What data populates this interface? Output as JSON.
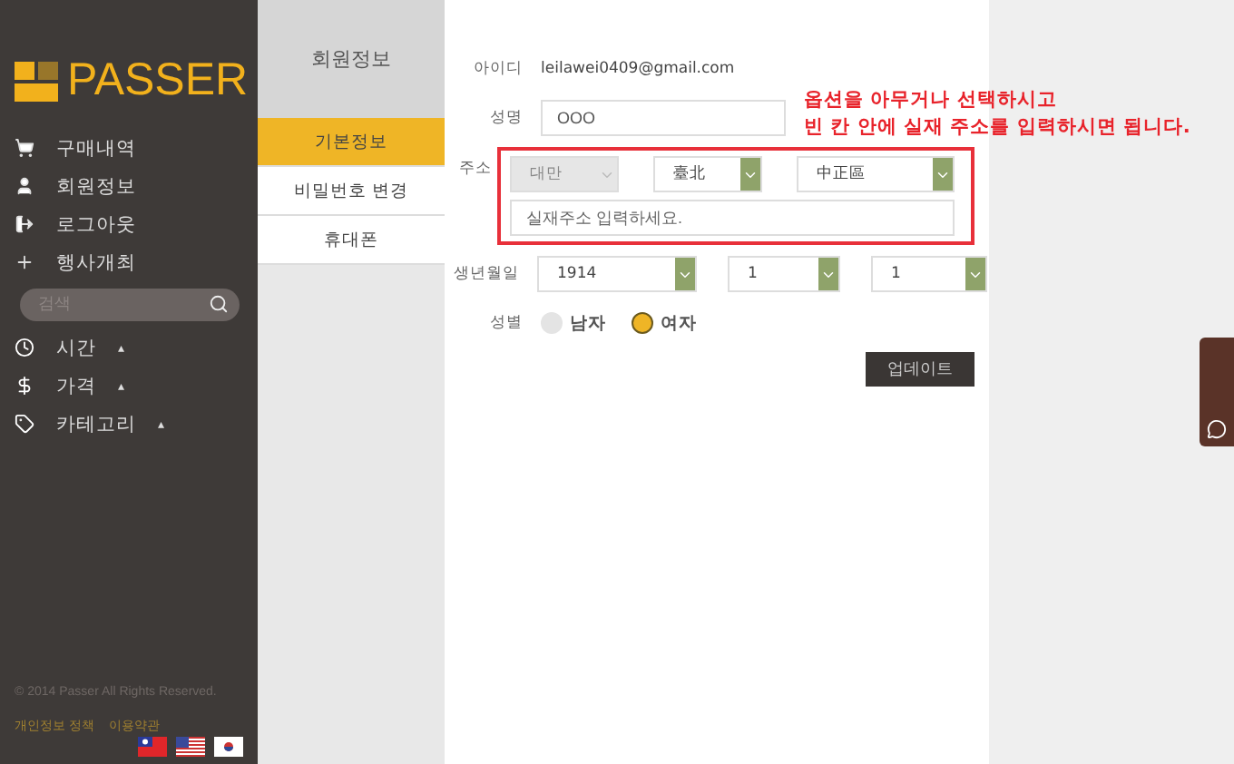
{
  "sidebar": {
    "logo": "PASSER",
    "nav": [
      {
        "label": "구매내역"
      },
      {
        "label": "회원정보"
      },
      {
        "label": "로그아웃"
      },
      {
        "label": "행사개최"
      }
    ],
    "search": {
      "placeholder": "검색"
    },
    "filters": [
      {
        "label": "시간",
        "caret": "▴"
      },
      {
        "label": "가격",
        "caret": "▴"
      },
      {
        "label": "카테고리",
        "caret": "▴"
      }
    ],
    "copyright": "© 2014 Passer All Rights Reserved.",
    "links": [
      "개인정보 정책",
      "이용약관"
    ]
  },
  "submenu": {
    "title": "회원정보",
    "items": [
      {
        "label": "기본정보",
        "selected": true
      },
      {
        "label": "비밀번호 변경",
        "selected": false
      },
      {
        "label": "휴대폰",
        "selected": false
      }
    ]
  },
  "form": {
    "id_label": "아이디",
    "id_value": "leilawei0409@gmail.com",
    "name_label": "성명",
    "name_value": "OOO",
    "address_label": "주소",
    "address_selects": [
      {
        "value": "대만",
        "disabled": true
      },
      {
        "value": "臺北",
        "disabled": false
      },
      {
        "value": "中正區",
        "disabled": false
      }
    ],
    "address_placeholder": "실재주소 입력하세요.",
    "birth_label": "생년월일",
    "birth_selects": [
      {
        "value": "1914",
        "disabled": false
      },
      {
        "value": "1",
        "disabled": false
      },
      {
        "value": "1",
        "disabled": false
      }
    ],
    "gender_label": "성별",
    "genders": [
      {
        "label": "남자",
        "selected": false
      },
      {
        "label": "여자",
        "selected": true
      }
    ],
    "update": "업데이트"
  },
  "annotation": [
    "옵션을 아무거나 선택하시고",
    "빈 칸 안에 실재 주소를 입력하시면 됩니다."
  ]
}
